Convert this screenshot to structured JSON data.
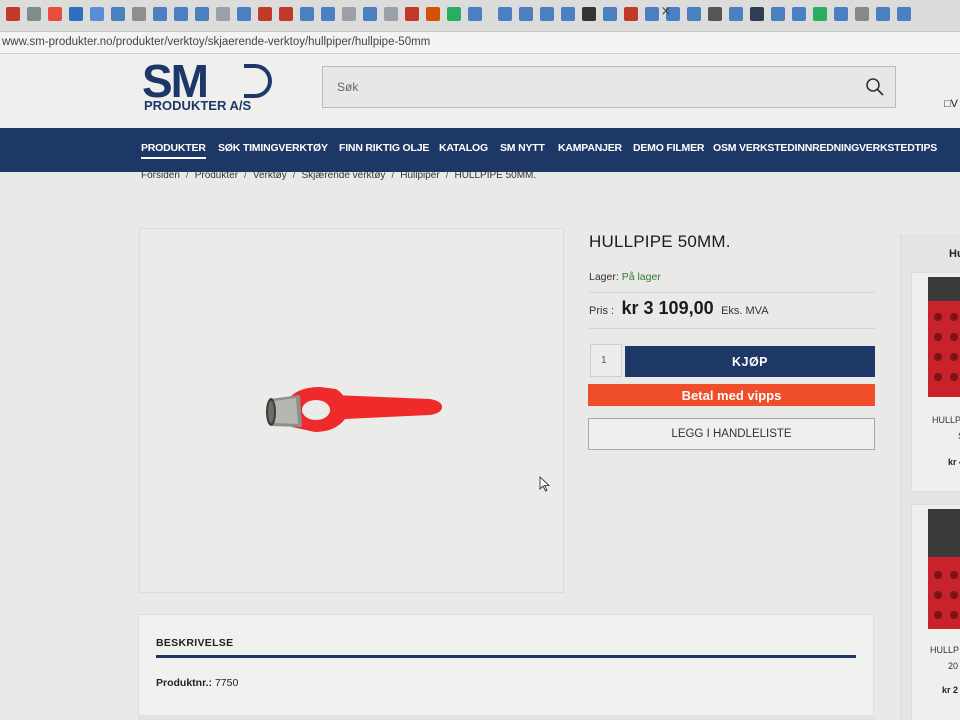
{
  "browser": {
    "url": "www.sm-produkter.no/produkter/verktoy/skjaerende-verktoy/hullpiper/hullpipe-50mm"
  },
  "header": {
    "logo_main": "SM",
    "logo_sub": "PRODUKTER A/S",
    "search_placeholder": "Søk",
    "right_fragment": "V"
  },
  "nav": {
    "items": [
      {
        "label": "PRODUKTER"
      },
      {
        "label": "SØK TIMINGVERKTØY"
      },
      {
        "label": "FINN RIKTIG OLJE"
      },
      {
        "label": "KATALOG"
      },
      {
        "label": "SM NYTT"
      },
      {
        "label": "KAMPANJER"
      },
      {
        "label": "DEMO FILMER"
      },
      {
        "label": "OSM VERKSTEDINNREDNING"
      },
      {
        "label": "VERKSTEDTIPS"
      }
    ]
  },
  "breadcrumb": [
    "Forsiden",
    "Produkter",
    "Verktøy",
    "Skjærende verktøy",
    "Hullpiper",
    "HULLPIPE 50MM."
  ],
  "product": {
    "title": "HULLPIPE 50MM.",
    "stock_label": "Lager:",
    "stock_value": "På lager",
    "price_label": "Pris :",
    "price_value": "kr 3 109,00",
    "price_suffix": "Eks. MVA",
    "quantity": "1",
    "buy_label": "KJØP",
    "vipps_label": "Betal med vipps",
    "list_label": "LEGG I HANDLELISTE"
  },
  "description": {
    "heading": "BESKRIVELSE",
    "prodnr_label": "Produktnr.:",
    "prodnr_value": "7750"
  },
  "side_panel": {
    "heading": "Hu",
    "items": [
      {
        "name_line1": "HULLP",
        "name_line2": "S",
        "price": "kr 4"
      },
      {
        "name_line1": "HULLP",
        "name_line2": "20",
        "price": "kr 2"
      }
    ]
  },
  "colors": {
    "brand_navy": "#1d3766",
    "vipps_orange": "#f04e2a",
    "stock_green": "#2e7d32",
    "tool_red": "#ef2a2a"
  }
}
